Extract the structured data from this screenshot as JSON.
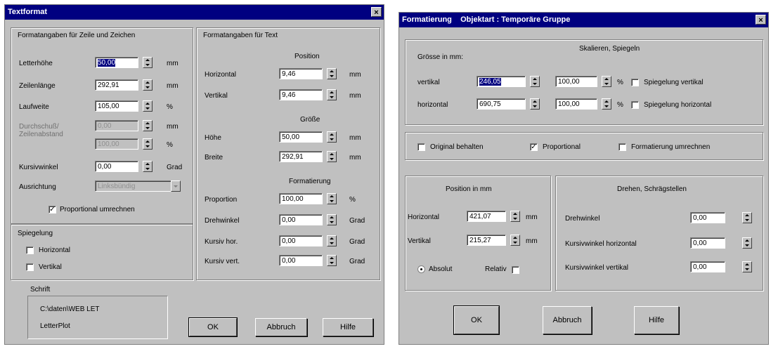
{
  "d1": {
    "title": "Textformat",
    "close_glyph": "×",
    "grp_zeile": "Formatangaben für Zeile und Zeichen",
    "grp_text": "Formatangaben für Text",
    "letterhoehe_label": "Letterhöhe",
    "letterhoehe_value": "50,00",
    "zeilenlaenge_label": "Zeilenlänge",
    "zeilenlaenge_value": "292,91",
    "laufweite_label": "Laufweite",
    "laufweite_value": "105,00",
    "durchschuss_label1": "Durchschuß/",
    "durchschuss_label2": "Zeilenabstand",
    "durchschuss_value": "0,00",
    "zeilenabstand_value": "100,00",
    "kursiv_label": "Kursivwinkel",
    "kursiv_value": "0,00",
    "ausrichtung_label": "Ausrichtung",
    "ausrichtung_value": "Linksbündig",
    "prop_umrechnen_label": "Proportional umrechnen",
    "prop_umrechnen_check": "✓",
    "spiegelung_label": "Spiegelung",
    "horizontal_label": "Horizontal",
    "vertikal_label": "Vertikal",
    "position_header": "Position",
    "horizontal_pos_label": "Horizontal",
    "horizontal_pos_value": "9,46",
    "vertikal_pos_label": "Vertikal",
    "vertikal_pos_value": "9,46",
    "groesse_header": "Größe",
    "hoehe_label": "Höhe",
    "hoehe_value": "50,00",
    "breite_label": "Breite",
    "breite_value": "292,91",
    "formatierung_header": "Formatierung",
    "proportion_label": "Proportion",
    "proportion_value": "100,00",
    "drehwinkel_label": "Drehwinkel",
    "drehwinkel_value": "0,00",
    "kursiv_hor_label": "Kursiv hor.",
    "kursiv_hor_value": "0,00",
    "kursiv_vert_label": "Kursiv vert.",
    "kursiv_vert_value": "0,00",
    "schrift_label": "Schrift",
    "schrift_path": "C:\\daten\\WEB LET",
    "schrift_name": "LetterPlot",
    "ok": "OK",
    "abbruch": "Abbruch",
    "hilfe": "Hilfe",
    "unit_mm": "mm",
    "unit_pct": "%",
    "unit_grad": "Grad"
  },
  "d2": {
    "title": "Formatierung    Objektart : Temporäre Gruppe",
    "close_glyph": "×",
    "grp_skal": "Skalieren, Spiegeln",
    "groesse_label": "Grösse in mm:",
    "vertikal_label": "vertikal",
    "vertikal_value": "246,05",
    "vertikal_pct": "100,00",
    "horizontal_label": "horizontal",
    "horizontal_value": "690,75",
    "horizontal_pct": "100,00",
    "spieg_vert": "Spiegelung vertikal",
    "spieg_hor": "Spiegelung horizontal",
    "original": "Original behalten",
    "proportional": "Proportional",
    "proportional_check": "✓",
    "umrechnen": "Formatierung umrechnen",
    "position_header": "Position in mm",
    "horizontal_pos_label": "Horizontal",
    "horizontal_pos_value": "421,07",
    "vertikal_pos_label": "Vertikal",
    "vertikal_pos_value": "215,27",
    "absolut": "Absolut",
    "relativ": "Relativ",
    "drehen_header": "Drehen, Schrägstellen",
    "drehwinkel_label": "Drehwinkel",
    "drehwinkel_value": "0,00",
    "kursiv_hor_label": "Kursivwinkel horizontal",
    "kursiv_hor_value": "0,00",
    "kursiv_vert_label": "Kursivwinkel vertikal",
    "kursiv_vert_value": "0,00",
    "ok": "OK",
    "abbruch": "Abbruch",
    "hilfe": "Hilfe",
    "unit_mm": "mm",
    "unit_pct": "%"
  }
}
